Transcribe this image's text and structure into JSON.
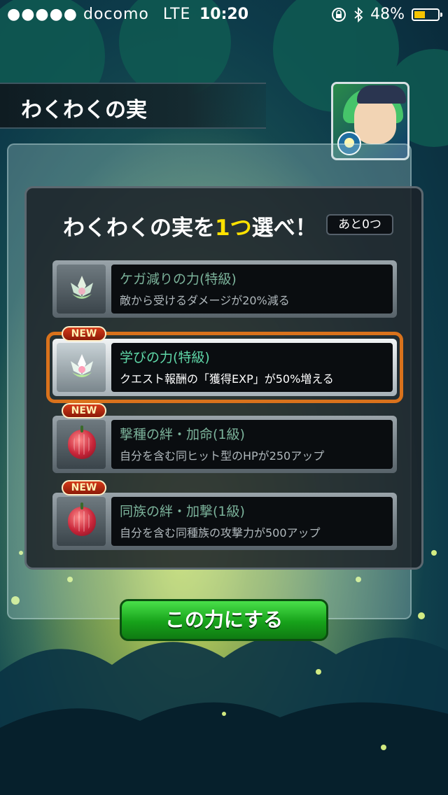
{
  "status_bar": {
    "signal": "●●●●●",
    "carrier": "docomo",
    "network": "LTE",
    "time": "10:20",
    "battery_percent": "48%",
    "battery_level": 0.48,
    "icons": [
      "rotation-lock-icon",
      "bluetooth-icon",
      "battery-icon"
    ]
  },
  "header": {
    "title": "わくわくの実"
  },
  "dialog": {
    "prompt_prefix": "わくわくの実を",
    "prompt_count": "1つ",
    "prompt_suffix": "選べ！",
    "remaining": "あと0つ"
  },
  "options": [
    {
      "title": "ケガ減りの力(特級)",
      "desc": "敵から受けるダメージが20%減る",
      "new": false,
      "selected": false,
      "icon": "lotus-fruit-icon"
    },
    {
      "title": "学びの力(特級)",
      "desc": "クエスト報酬の「獲得EXP」が50%増える",
      "new": true,
      "selected": true,
      "icon": "lotus-fruit-icon"
    },
    {
      "title": "撃種の絆・加命(1級)",
      "desc": "自分を含む同ヒット型のHPが250アップ",
      "new": true,
      "selected": false,
      "icon": "red-fruit-icon"
    },
    {
      "title": "同族の絆・加撃(1級)",
      "desc": "自分を含む同種族の攻撃力が500アップ",
      "new": true,
      "selected": false,
      "icon": "red-fruit-icon"
    }
  ],
  "new_tag": "NEW",
  "confirm_button": "この力にする",
  "colors": {
    "accent_yellow": "#ffe200",
    "selection_orange": "#d9721c",
    "button_green": "#17a21a",
    "option_title_green": "#7bb29a"
  }
}
